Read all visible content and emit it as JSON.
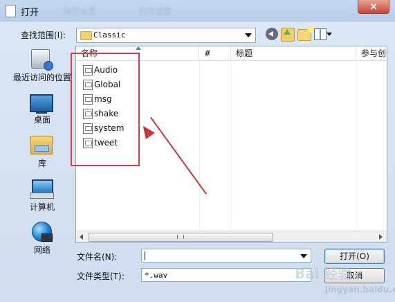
{
  "window": {
    "title": "打开",
    "blurred_tabs": [
      "保存设置",
      "另存设置"
    ]
  },
  "location": {
    "label": "查找范围(I):",
    "current_folder": "Classic"
  },
  "sidebar": {
    "items": [
      {
        "label": "最近访问的位置",
        "icon": "recent-places-icon"
      },
      {
        "label": "桌面",
        "icon": "desktop-icon"
      },
      {
        "label": "库",
        "icon": "library-icon"
      },
      {
        "label": "计算机",
        "icon": "computer-icon"
      },
      {
        "label": "网络",
        "icon": "network-icon"
      }
    ]
  },
  "file_list": {
    "columns": [
      "名称",
      "#",
      "标题",
      "参与创作"
    ],
    "files": [
      "Audio",
      "Global",
      "msg",
      "shake",
      "system",
      "tweet"
    ]
  },
  "bottom": {
    "filename_label": "文件名(N):",
    "filename_value": "",
    "filetype_label": "文件类型(T):",
    "filetype_value": "*.wav",
    "open_button": "打开(O)",
    "cancel_button": "取消"
  },
  "annotation": {
    "color": "#d83d43"
  },
  "watermark": {
    "text": "Bai 经验",
    "url": "jingyan.baidu.com"
  }
}
